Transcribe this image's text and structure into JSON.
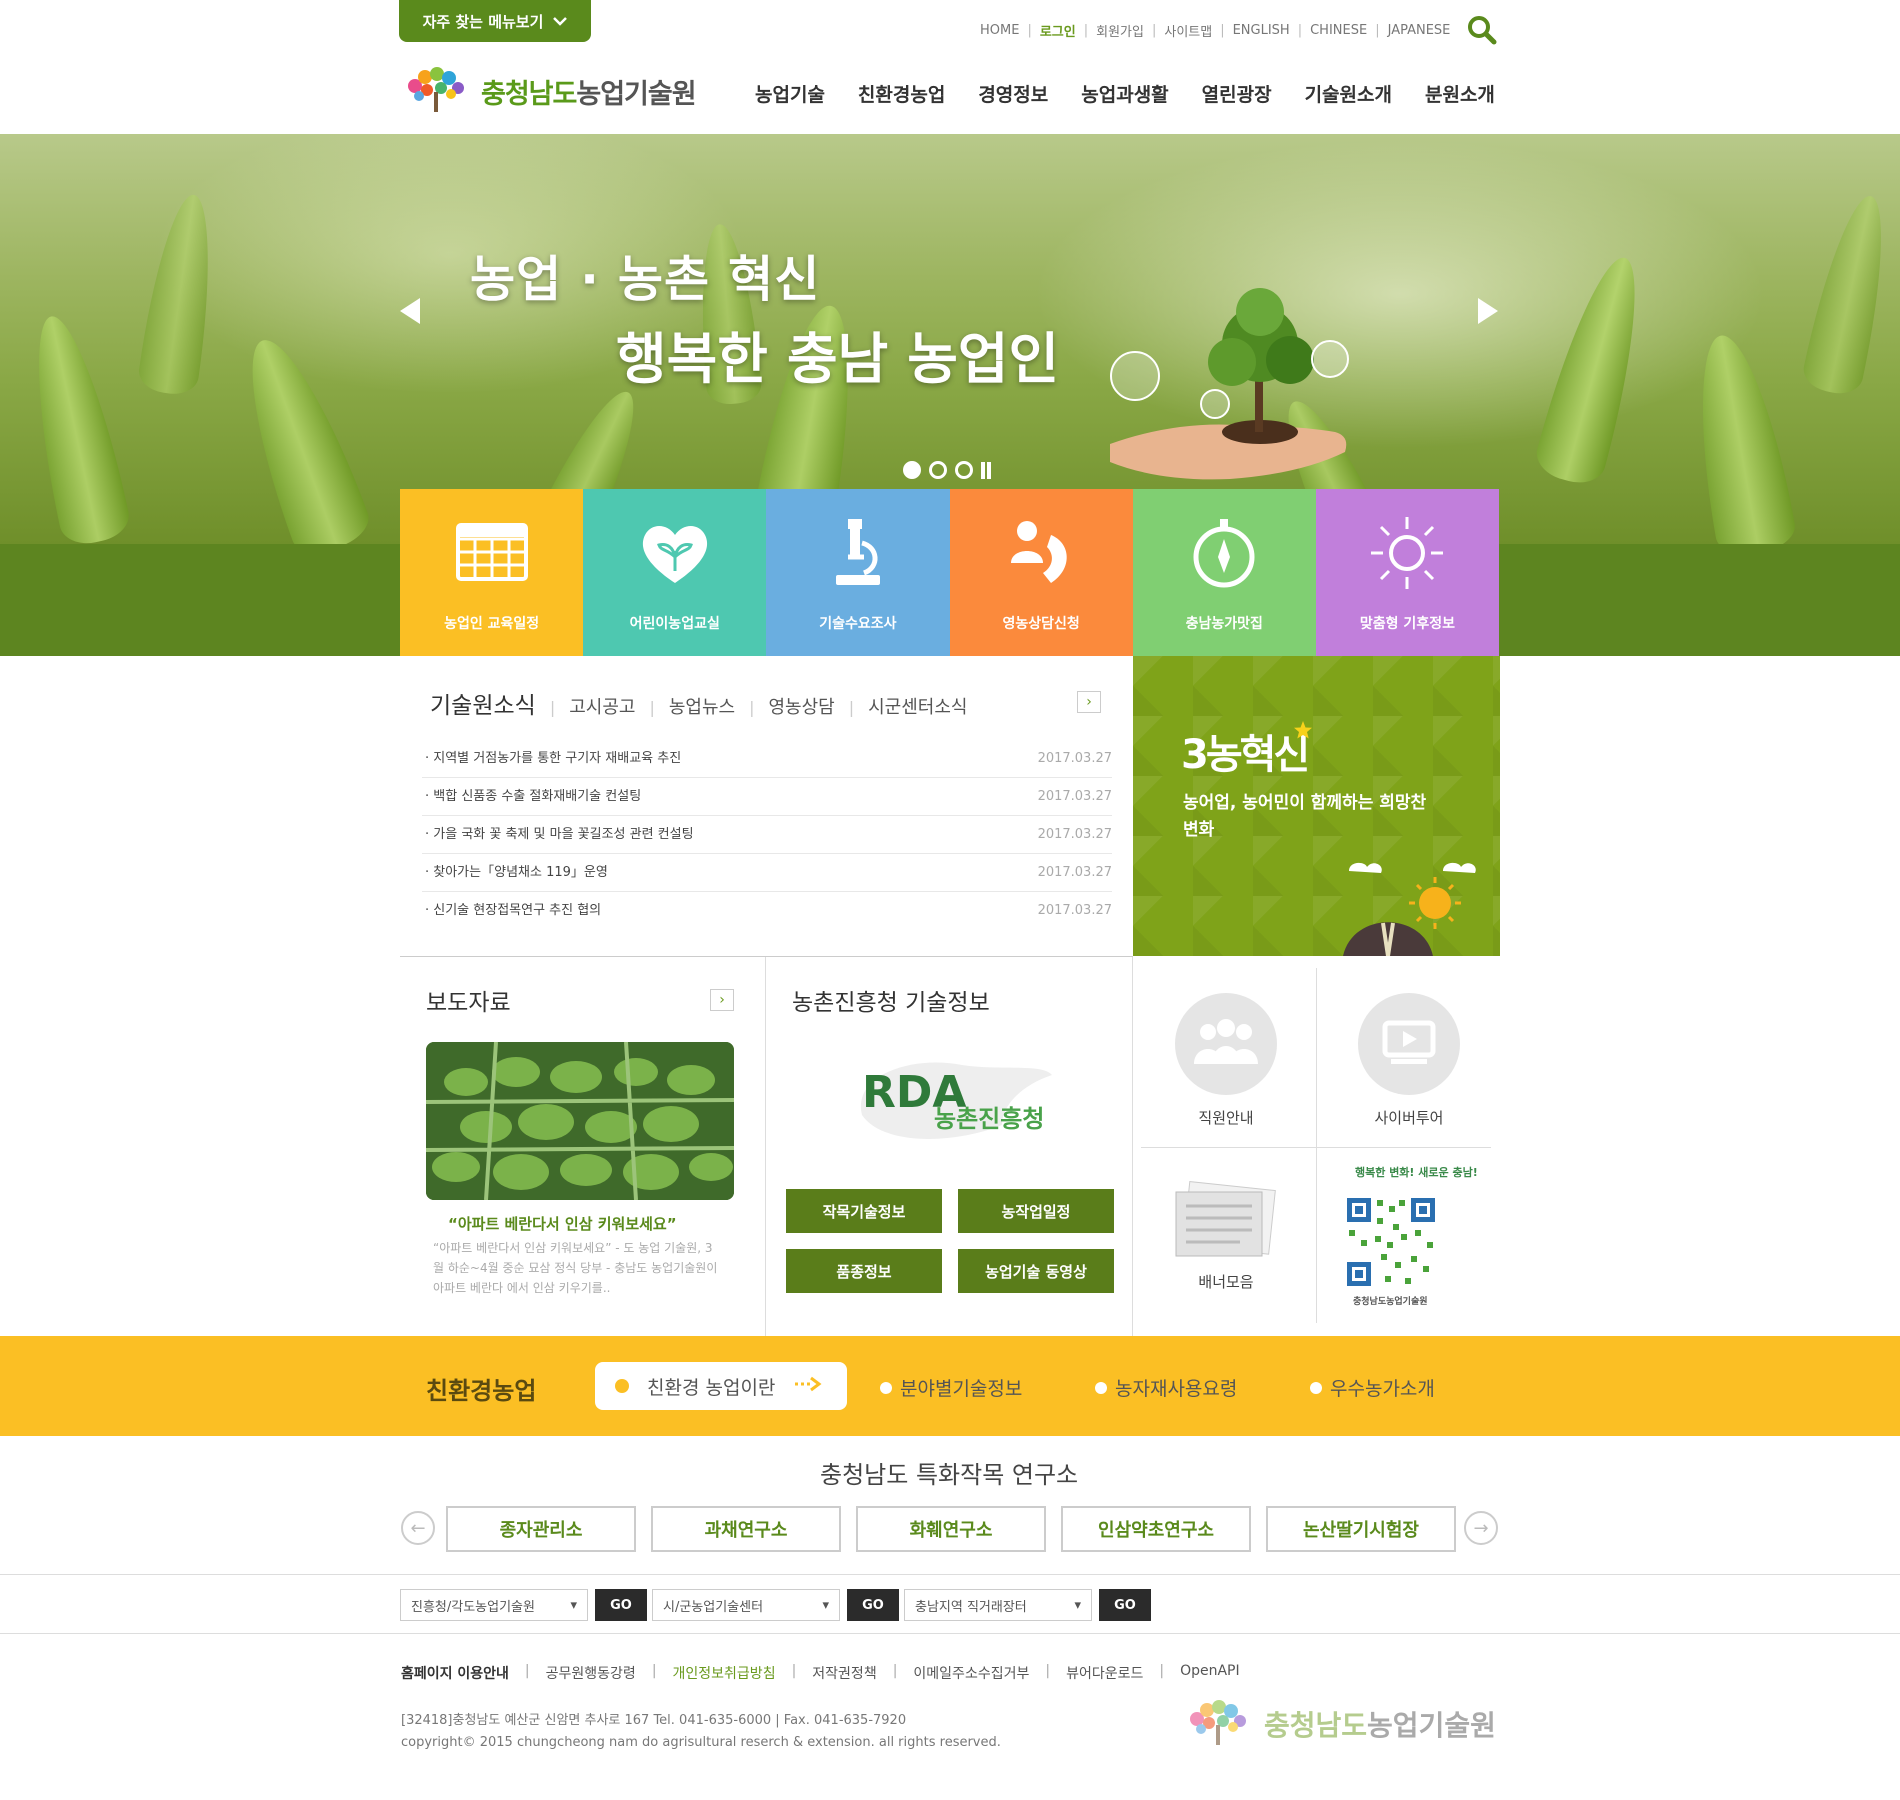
{
  "header": {
    "faq_label": "자주 찾는 메뉴보기",
    "util_links": [
      "HOME",
      "로그인",
      "회원가입",
      "사이트맵",
      "ENGLISH",
      "CHINESE",
      "JAPANESE"
    ],
    "logo_prefix": "충청남도",
    "logo_suffix": "농업기술원",
    "gnb": [
      "농업기술",
      "친환경농업",
      "경영정보",
      "농업과생활",
      "열린광장",
      "기술원소개",
      "분원소개"
    ]
  },
  "hero": {
    "line1": "농업 · 농촌 혁신",
    "line2": "행복한 충남 농업인"
  },
  "tiles": [
    {
      "label": "농업인 교육일정",
      "color": "#fbbf24",
      "icon": "calendar-icon"
    },
    {
      "label": "어린이농업교실",
      "color": "#4ec8b0",
      "icon": "heart-sprout-icon"
    },
    {
      "label": "기술수요조사",
      "color": "#6aaee0",
      "icon": "microscope-icon"
    },
    {
      "label": "영농상담신청",
      "color": "#fb8a3c",
      "icon": "phone-person-icon"
    },
    {
      "label": "충남농가맛집",
      "color": "#80cf72",
      "icon": "compass-icon"
    },
    {
      "label": "맞춤형 기후정보",
      "color": "#c17fdb",
      "icon": "sun-icon"
    }
  ],
  "news": {
    "tabs": [
      "기술원소식",
      "고시공고",
      "농업뉴스",
      "영농상담",
      "시군센터소식"
    ],
    "more": "›",
    "items": [
      {
        "title": "지역별 거점농가를 통한 구기자 재배교육 추진",
        "date": "2017.03.27"
      },
      {
        "title": "백합 신품종 수출 절화재배기술 컨설팅",
        "date": "2017.03.27"
      },
      {
        "title": "가을 국화 꽃 축제 및 마을 꽃길조성 관련 컨설팅",
        "date": "2017.03.27"
      },
      {
        "title": "찾아가는「양념채소 119」운영",
        "date": "2017.03.27"
      },
      {
        "title": "신기술 현장접목연구 추진 협의",
        "date": "2017.03.27"
      }
    ]
  },
  "promo": {
    "title": "3농혁신",
    "desc": "농어업, 농어민이 함께하는 희망찬 변화"
  },
  "press": {
    "title": "보도자료",
    "more": "›",
    "headline": "“아파트 베란다서 인삼 키워보세요”",
    "body": "“아파트 베란다서 인삼 키워보세요” - 도 농업 기술원, 3월 하순~4월 중순 묘삼 정식 당부 - 충남도 농업기술원이 아파트 베란다 에서 인삼 키우기를.."
  },
  "rda": {
    "title": "농촌진흥청 기술정보",
    "logo_letters": "RDA",
    "logo_name": "농촌진흥청",
    "buttons": [
      "작목기술정보",
      "농작업일정",
      "품종정보",
      "농업기술 동영상"
    ]
  },
  "quick": {
    "staff": "직원안내",
    "cyber": "사이버투어",
    "banner": "배너모음",
    "qr_top": "행복한 변화! 새로운 충남!",
    "qr_bottom": "충청남도농업기술원"
  },
  "eco": {
    "title": "친환경농업",
    "active": "친환경 농업이란",
    "links": [
      "분야별기술정보",
      "농자재사용요령",
      "우수농가소개"
    ]
  },
  "research": {
    "title": "충청남도 특화작목 연구소",
    "prev": "←",
    "next": "→",
    "items": [
      "종자관리소",
      "과채연구소",
      "화훼연구소",
      "인삼약초연구소",
      "논산딸기시험장"
    ]
  },
  "selects": [
    {
      "value": "진흥청/각도농업기술원",
      "go": "GO"
    },
    {
      "value": "시/군농업기술센터",
      "go": "GO"
    },
    {
      "value": "충남지역 직거래장터",
      "go": "GO"
    }
  ],
  "footer": {
    "links": [
      "홈페이지 이용안내",
      "공무원행동강령",
      "개인정보취급방침",
      "저작권정책",
      "이메일주소수집거부",
      "뷰어다운로드",
      "OpenAPI"
    ],
    "address": "[32418]충청남도 예산군 신암면 추사로 167 Tel. 041-635-6000 | Fax. 041-635-7920",
    "copyright": "copyright© 2015 chungcheong nam do agrisultural reserch & extension. all rights reserved.",
    "logo_prefix": "충청남도",
    "logo_suffix": "농업기술원"
  }
}
